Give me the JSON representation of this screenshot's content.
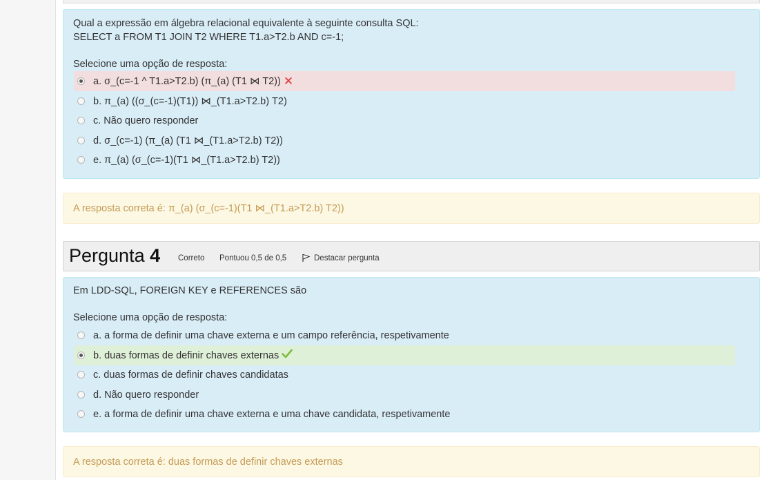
{
  "q3": {
    "text_line1": "Qual a expressão em álgebra relacional equivalente à seguinte consulta SQL:",
    "text_line2": "SELECT a FROM T1 JOIN T2 WHERE T1.a>T2.b AND c=-1;",
    "prompt": "Selecione uma opção de resposta:",
    "options": [
      {
        "label": "a. σ_(c=-1 ^ T1.a>T2.b) (π_(a) (T1 ⋈ T2))",
        "selected": true,
        "status": "incorrect"
      },
      {
        "label": "b. π_(a) ((σ_(c=-1)(T1)) ⋈_(T1.a>T2.b) T2)",
        "selected": false
      },
      {
        "label": "c. Não quero responder",
        "selected": false
      },
      {
        "label": "d. σ_(c=-1) (π_(a) (T1 ⋈_(T1.a>T2.b) T2))",
        "selected": false
      },
      {
        "label": "e. π_(a) (σ_(c=-1)(T1 ⋈_(T1.a>T2.b) T2))",
        "selected": false
      }
    ],
    "feedback": "A resposta correta é: π_(a) (σ_(c=-1)(T1 ⋈_(T1.a>T2.b) T2))"
  },
  "q4": {
    "header": {
      "prefix": "Pergunta",
      "number": "4",
      "state": "Correto",
      "grade": "Pontuou 0,5 de 0,5",
      "flag_label": "Destacar pergunta"
    },
    "text": "Em LDD-SQL, FOREIGN KEY e REFERENCES são",
    "prompt": "Selecione uma opção de resposta:",
    "options": [
      {
        "label": "a. a forma de definir uma chave externa e um campo referência, respetivamente",
        "selected": false
      },
      {
        "label": "b. duas formas de definir chaves externas",
        "selected": true,
        "status": "correct"
      },
      {
        "label": "c. duas formas de definir chaves candidatas",
        "selected": false
      },
      {
        "label": "d. Não quero responder",
        "selected": false
      },
      {
        "label": "e. a forma de definir uma chave externa e uma chave candidata, respetivamente",
        "selected": false
      }
    ],
    "feedback": "A resposta correta é: duas formas de definir chaves externas"
  },
  "colors": {
    "question_bg": "#d9edf7",
    "wrong_bg": "#f2dede",
    "right_bg": "#dff0d8",
    "feedback_bg": "#fcf8e3",
    "feedback_text": "#c59a54",
    "wrong_mark": "#e0302f",
    "correct_mark": "#7cbb3c"
  },
  "icons": {
    "incorrect": "x-icon",
    "correct": "check-icon",
    "flag": "flag-icon"
  }
}
